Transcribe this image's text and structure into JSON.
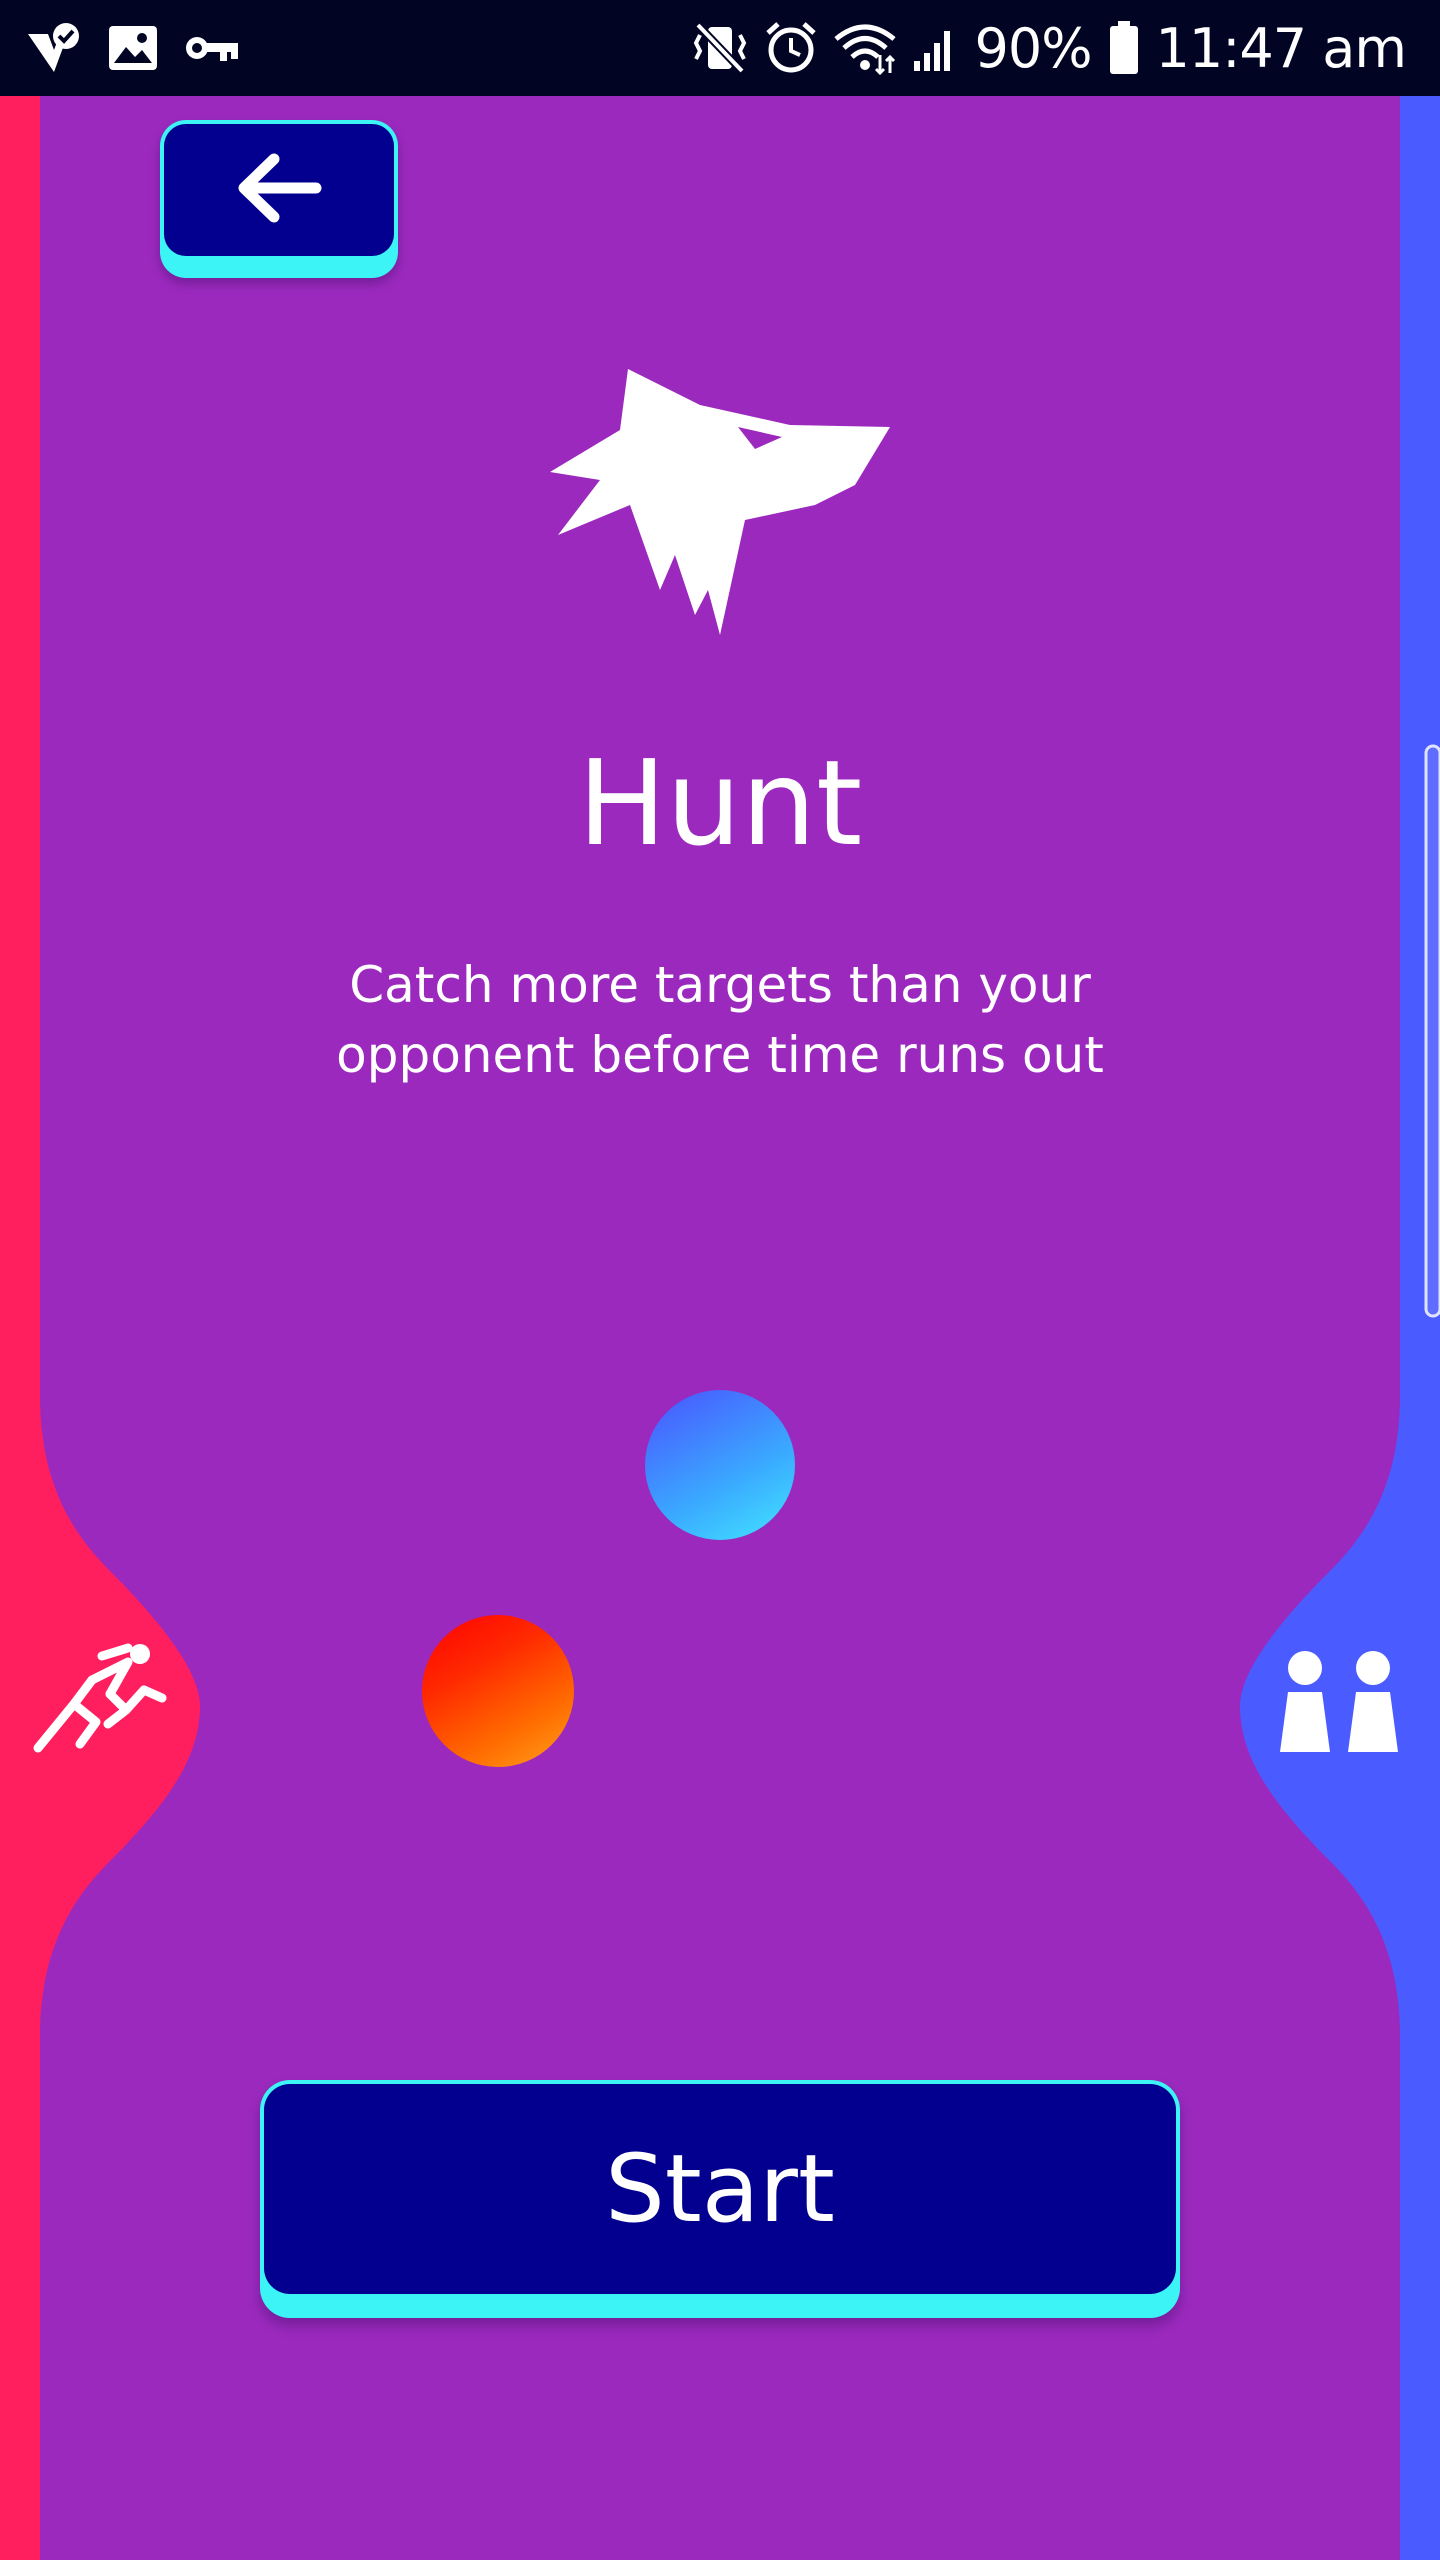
{
  "status_bar": {
    "battery_percent": "90%",
    "time": "11:47 am",
    "left_icons": [
      "check-badge-icon",
      "image-icon",
      "key-icon"
    ],
    "right_icons": [
      "vibrate-mute-icon",
      "alarm-icon",
      "wifi-icon",
      "signal-icon",
      "battery-icon"
    ]
  },
  "header": {
    "back_icon": "arrow-left-icon"
  },
  "mode": {
    "icon": "wolf-icon",
    "title": "Hunt",
    "description": "Catch more targets than your opponent before time runs out"
  },
  "players": {
    "left_icon": "runner-icon",
    "right_icon": "two-players-icon"
  },
  "actions": {
    "start_label": "Start"
  },
  "colors": {
    "background": "#9b29be",
    "left_panel": "#ff1f5e",
    "right_panel": "#4a5cff",
    "button_face": "#04008f",
    "button_edge": "#3cf3f6",
    "status_bar": "#020424"
  }
}
